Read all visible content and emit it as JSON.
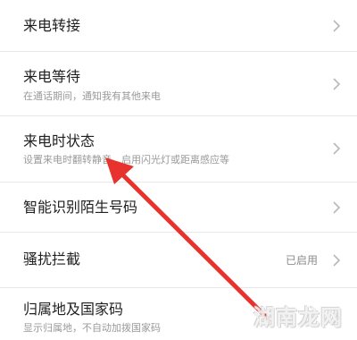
{
  "settings": {
    "items": [
      {
        "title": "来电转接",
        "subtitle": "",
        "status": ""
      },
      {
        "title": "来电等待",
        "subtitle": "在通话期间，通知我有其他来电",
        "status": ""
      },
      {
        "title": "来电时状态",
        "subtitle": "设置来电时翻转静音、启用闪光灯或距离感应等",
        "status": ""
      },
      {
        "title": "智能识别陌生号码",
        "subtitle": "",
        "status": ""
      },
      {
        "title": "骚扰拦截",
        "subtitle": "",
        "status": "已启用"
      },
      {
        "title": "归属地及国家码",
        "subtitle": "显示归属地，不自动加拨国家码",
        "status": ""
      }
    ]
  },
  "icons": {
    "row_chevron": "chevron-right-icon",
    "annotation": "red-arrow-pointer"
  },
  "annotation": {
    "arrow_color": "#e8322d"
  },
  "watermark": {
    "text": "湖南龙网"
  }
}
